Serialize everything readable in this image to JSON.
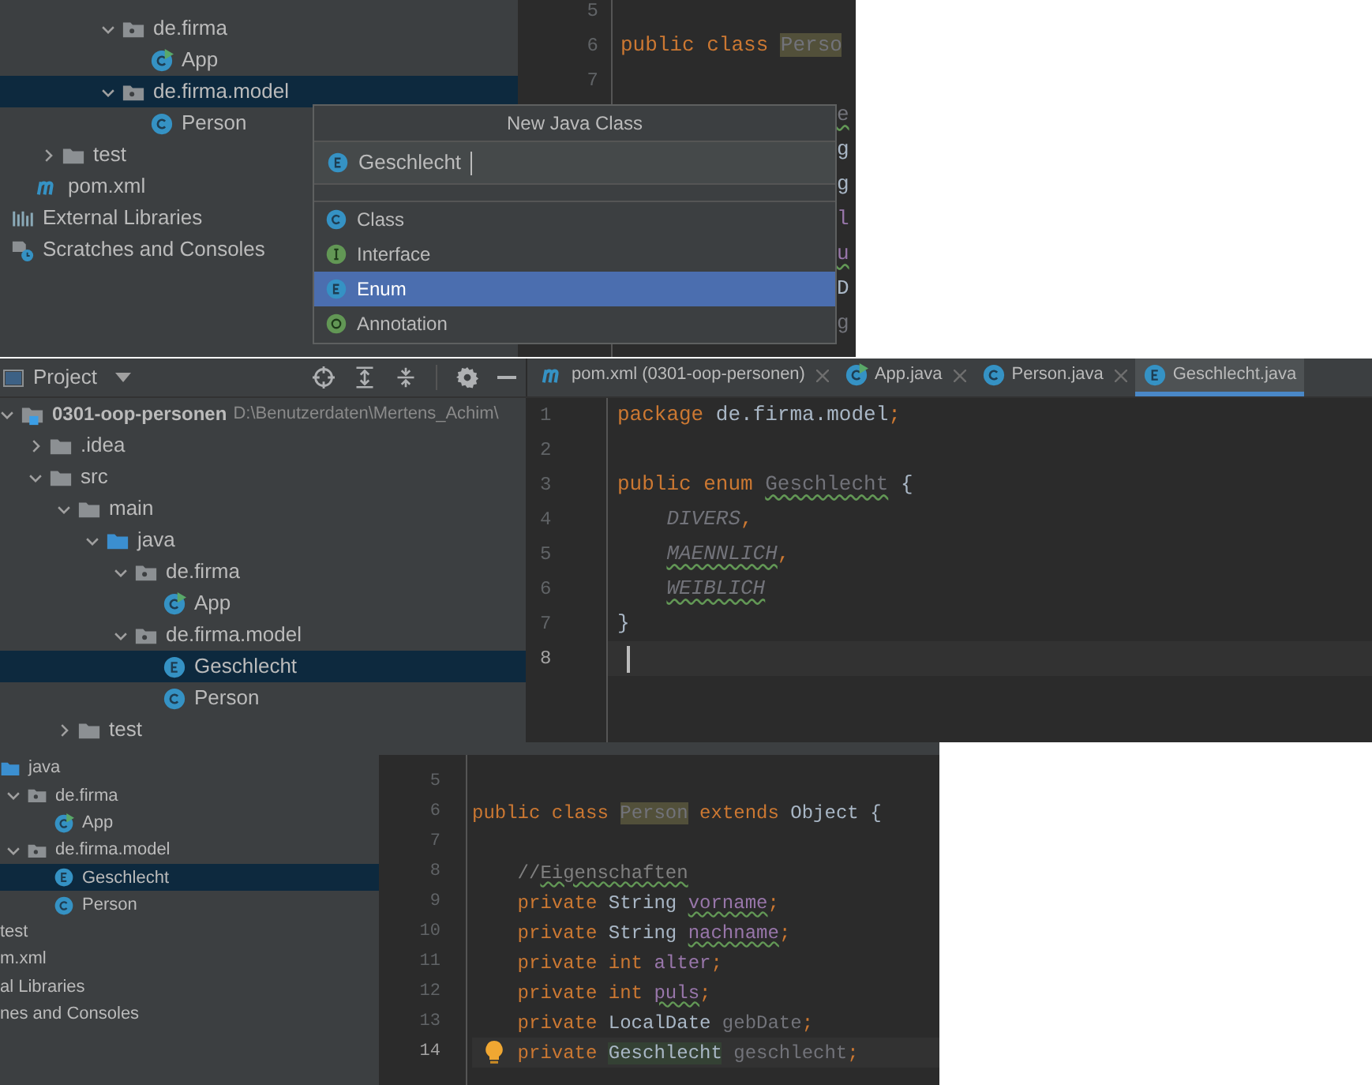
{
  "screen_1": {
    "project_tree": [
      {
        "label": "de.firma",
        "kind": "package",
        "expanded": true,
        "selected": false,
        "children": [
          {
            "label": "App",
            "kind": "app",
            "selected": false
          }
        ]
      },
      {
        "label": "de.firma.model",
        "kind": "package",
        "expanded": true,
        "selected": true,
        "children": [
          {
            "label": "Person",
            "kind": "class",
            "selected": false
          }
        ]
      },
      {
        "label": "test",
        "kind": "folder",
        "expanded": false,
        "selected": false
      },
      {
        "label": "pom.xml",
        "kind": "maven",
        "selected": false
      },
      {
        "label": "External Libraries",
        "kind": "libraries",
        "selected": false
      },
      {
        "label": "Scratches and Consoles",
        "kind": "scratches",
        "selected": false
      }
    ],
    "editor": {
      "lines": [
        {
          "number": "5"
        },
        {
          "number": "6",
          "tokens": [
            {
              "text": "public class ",
              "kind": "keyword"
            },
            {
              "text": "Perso",
              "kind": "class_highlight"
            }
          ]
        },
        {
          "number": "7"
        }
      ],
      "hidden_line_ends": [
        {
          "text": "e",
          "kind": "unused_typo"
        },
        {
          "text": "g",
          "kind": "plain"
        },
        {
          "text": "g",
          "kind": "plain"
        },
        {
          "text": "l",
          "kind": "field"
        },
        {
          "text": "u",
          "kind": "field_typo"
        },
        {
          "text": "D",
          "kind": "plain"
        },
        {
          "text": "g",
          "kind": "unused"
        }
      ]
    },
    "dialog": {
      "title": "New Java Class",
      "input": {
        "value": "Geschlecht",
        "kind": "enum"
      },
      "options": [
        {
          "label": "Class",
          "kind": "class",
          "selected": false
        },
        {
          "label": "Interface",
          "kind": "interface",
          "selected": false
        },
        {
          "label": "Enum",
          "kind": "enum",
          "selected": true
        },
        {
          "label": "Annotation",
          "kind": "annotation",
          "selected": false
        }
      ]
    }
  },
  "screen_2": {
    "tool_window": {
      "title": "Project"
    },
    "tabs": [
      {
        "label": "pom.xml (0301-oop-personen)",
        "kind": "maven",
        "selected": false
      },
      {
        "label": "App.java",
        "kind": "app",
        "selected": false
      },
      {
        "label": "Person.java",
        "kind": "class",
        "selected": false
      },
      {
        "label": "Geschlecht.java",
        "kind": "enum",
        "selected": true
      }
    ],
    "project_tree": [
      {
        "label": "0301-oop-personen",
        "path": "D:\\Benutzerdaten\\Mertens_Achim\\",
        "kind": "module",
        "expanded": true,
        "selected": false,
        "children": [
          {
            "label": ".idea",
            "kind": "folder",
            "expanded": false,
            "selected": false
          },
          {
            "label": "src",
            "kind": "folder",
            "expanded": true,
            "selected": false,
            "children": [
              {
                "label": "main",
                "kind": "folder",
                "expanded": true,
                "selected": false,
                "children": [
                  {
                    "label": "java",
                    "kind": "source",
                    "expanded": true,
                    "selected": false,
                    "children": [
                      {
                        "label": "de.firma",
                        "kind": "package",
                        "expanded": true,
                        "selected": false,
                        "children": [
                          {
                            "label": "App",
                            "kind": "app",
                            "selected": false
                          }
                        ]
                      },
                      {
                        "label": "de.firma.model",
                        "kind": "package",
                        "expanded": true,
                        "selected": false,
                        "children": [
                          {
                            "label": "Geschlecht",
                            "kind": "enum",
                            "selected": true
                          },
                          {
                            "label": "Person",
                            "kind": "class",
                            "selected": false
                          }
                        ]
                      }
                    ]
                  }
                ]
              },
              {
                "label": "test",
                "kind": "folder",
                "expanded": false,
                "selected": false
              }
            ]
          }
        ]
      }
    ],
    "editor": {
      "lines": [
        {
          "number": "1",
          "current": false,
          "indented": false,
          "tokens": [
            {
              "text": "package",
              "kind": "keyword"
            },
            {
              "text": " de.firma.model",
              "kind": "plain"
            },
            {
              "text": ";",
              "kind": "keyword"
            }
          ]
        },
        {
          "number": "2",
          "current": false
        },
        {
          "number": "3",
          "current": false,
          "indented": false,
          "tokens": [
            {
              "text": "public enum ",
              "kind": "keyword"
            },
            {
              "text": "Geschlecht",
              "kind": "unused_typo"
            },
            {
              "text": " {",
              "kind": "plain"
            }
          ]
        },
        {
          "number": "4",
          "current": false,
          "indented": true,
          "tokens": [
            {
              "text": "DIVERS",
              "kind": "constant"
            },
            {
              "text": ",",
              "kind": "keyword"
            }
          ]
        },
        {
          "number": "5",
          "current": false,
          "indented": true,
          "tokens": [
            {
              "text": "MAENNLICH",
              "kind": "constant_typo"
            },
            {
              "text": ",",
              "kind": "keyword"
            }
          ]
        },
        {
          "number": "6",
          "current": false,
          "indented": true,
          "tokens": [
            {
              "text": "WEIBLICH",
              "kind": "constant_typo"
            }
          ]
        },
        {
          "number": "7",
          "current": false,
          "indented": false,
          "tokens": [
            {
              "text": "}",
              "kind": "plain"
            }
          ]
        },
        {
          "number": "8",
          "current": true
        }
      ]
    }
  },
  "screen_3": {
    "project_tree": [
      {
        "label": "java",
        "kind": "source",
        "expanded": true,
        "selected": false,
        "children": [
          {
            "label": "de.firma",
            "kind": "package",
            "expanded": true,
            "selected": false,
            "children": [
              {
                "label": "App",
                "kind": "app",
                "selected": false
              }
            ]
          },
          {
            "label": "de.firma.model",
            "kind": "package",
            "expanded": true,
            "selected": false,
            "children": [
              {
                "label": "Geschlecht",
                "kind": "enum",
                "selected": true
              },
              {
                "label": "Person",
                "kind": "class",
                "selected": false
              }
            ]
          }
        ]
      },
      {
        "label": "test",
        "kind": "folder",
        "expanded": false,
        "selected": false
      },
      {
        "label": "m.xml",
        "kind": "maven",
        "selected": false
      },
      {
        "label": "al Libraries",
        "kind": "libraries",
        "selected": false
      },
      {
        "label": "nes and Consoles",
        "kind": "scratches",
        "selected": false
      }
    ],
    "editor": {
      "lines": [
        {
          "number": "5",
          "current": false
        },
        {
          "number": "6",
          "current": false,
          "indented": false,
          "tokens": [
            {
              "text": "public class ",
              "kind": "keyword"
            },
            {
              "text": "Person",
              "kind": "class_highlight"
            },
            {
              "text": " extends ",
              "kind": "keyword"
            },
            {
              "text": "Object {",
              "kind": "plain"
            }
          ]
        },
        {
          "number": "7",
          "current": false
        },
        {
          "number": "8",
          "current": false,
          "indented": true,
          "tokens": [
            {
              "text": "//",
              "kind": "comment"
            },
            {
              "text": "Eigenschaften",
              "kind": "comment_typo"
            }
          ]
        },
        {
          "number": "9",
          "current": false,
          "indented": true,
          "tokens": [
            {
              "text": "private ",
              "kind": "keyword"
            },
            {
              "text": "String ",
              "kind": "plain"
            },
            {
              "text": "vorname",
              "kind": "field_typo"
            },
            {
              "text": ";",
              "kind": "keyword"
            }
          ]
        },
        {
          "number": "10",
          "current": false,
          "indented": true,
          "tokens": [
            {
              "text": "private ",
              "kind": "keyword"
            },
            {
              "text": "String ",
              "kind": "plain"
            },
            {
              "text": "nachname",
              "kind": "field_typo"
            },
            {
              "text": ";",
              "kind": "keyword"
            }
          ]
        },
        {
          "number": "11",
          "current": false,
          "indented": true,
          "tokens": [
            {
              "text": "private int ",
              "kind": "keyword"
            },
            {
              "text": "alter",
              "kind": "field"
            },
            {
              "text": ";",
              "kind": "keyword"
            }
          ]
        },
        {
          "number": "12",
          "current": false,
          "indented": true,
          "tokens": [
            {
              "text": "private int ",
              "kind": "keyword"
            },
            {
              "text": "puls",
              "kind": "field_typo"
            },
            {
              "text": ";",
              "kind": "keyword"
            }
          ]
        },
        {
          "number": "13",
          "current": false,
          "indented": true,
          "tokens": [
            {
              "text": "private ",
              "kind": "keyword"
            },
            {
              "text": "LocalDate ",
              "kind": "plain"
            },
            {
              "text": "gebDate",
              "kind": "unused"
            },
            {
              "text": ";",
              "kind": "keyword"
            }
          ]
        },
        {
          "number": "14",
          "current": true,
          "indented": true,
          "tokens": [
            {
              "text": "private ",
              "kind": "keyword"
            },
            {
              "text": "Geschlecht",
              "kind": "type_highlight"
            },
            {
              "text": " geschlecht",
              "kind": "unused"
            },
            {
              "text": ";",
              "kind": "keyword"
            }
          ]
        }
      ]
    }
  }
}
